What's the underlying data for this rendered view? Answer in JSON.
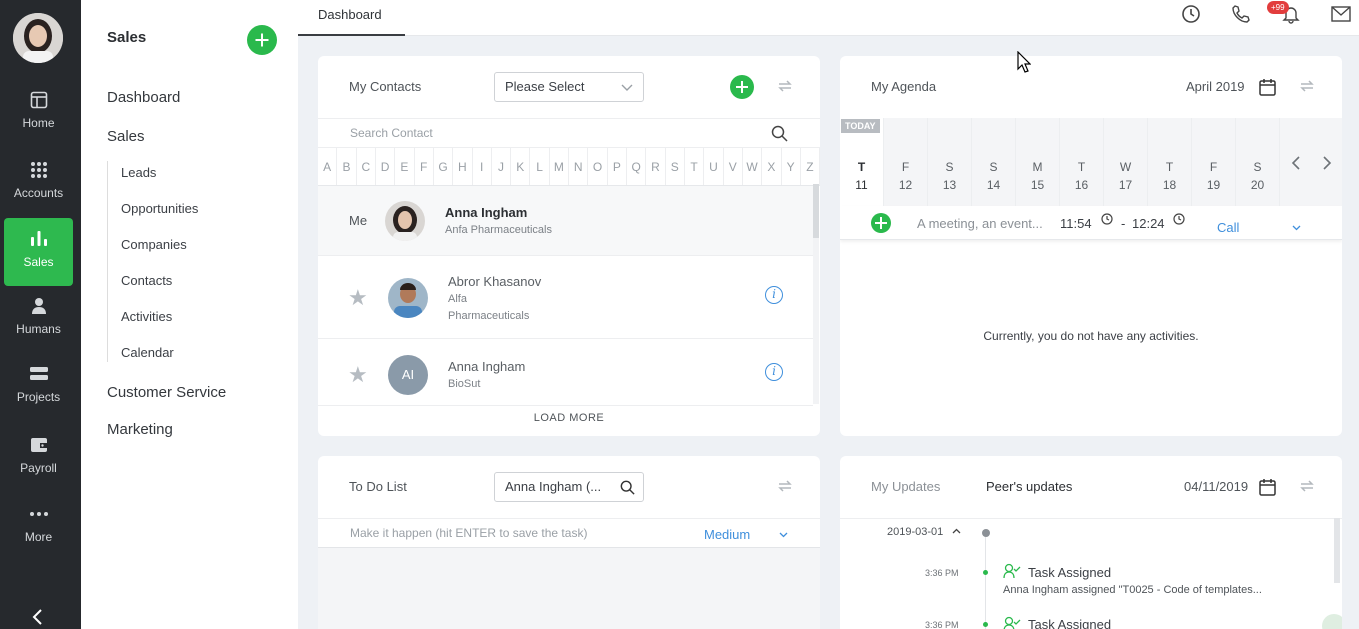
{
  "nav": {
    "items": [
      {
        "label": "Home",
        "icon": "home-icon"
      },
      {
        "label": "Accounts",
        "icon": "grid-icon"
      },
      {
        "label": "Sales",
        "icon": "bar-chart-icon"
      },
      {
        "label": "Humans",
        "icon": "person-icon"
      },
      {
        "label": "Projects",
        "icon": "projects-icon"
      },
      {
        "label": "Payroll",
        "icon": "wallet-icon"
      },
      {
        "label": "More",
        "icon": "more-icon"
      }
    ],
    "active": "Sales"
  },
  "sidebar": {
    "title": "Sales",
    "sections": [
      "Dashboard",
      "Sales",
      "Customer Service",
      "Marketing"
    ],
    "sub_items": [
      "Leads",
      "Opportunities",
      "Companies",
      "Contacts",
      "Activities",
      "Calendar"
    ]
  },
  "topbar": {
    "tab": "Dashboard",
    "badge": "+99"
  },
  "contacts": {
    "title": "My Contacts",
    "select": "Please Select",
    "search_placeholder": "Search Contact",
    "letters": [
      "A",
      "B",
      "C",
      "D",
      "E",
      "F",
      "G",
      "H",
      "I",
      "J",
      "K",
      "L",
      "M",
      "N",
      "O",
      "P",
      "Q",
      "R",
      "S",
      "T",
      "U",
      "V",
      "W",
      "X",
      "Y",
      "Z"
    ],
    "me_label": "Me",
    "me": {
      "name": "Anna Ingham",
      "company": "Anfa Pharmaceuticals"
    },
    "rows": [
      {
        "name": "Abror Khasanov",
        "company_line1": "Alfa",
        "company_line2": "Pharmaceuticals",
        "initials": ""
      },
      {
        "name": "Anna Ingham",
        "company_line1": "BioSut",
        "company_line2": "",
        "initials": "AI"
      }
    ],
    "load_more": "LOAD MORE"
  },
  "agenda": {
    "title": "My Agenda",
    "month": "April 2019",
    "today_label": "TODAY",
    "days": [
      {
        "dow": "T",
        "date": "11"
      },
      {
        "dow": "F",
        "date": "12"
      },
      {
        "dow": "S",
        "date": "13"
      },
      {
        "dow": "S",
        "date": "14"
      },
      {
        "dow": "M",
        "date": "15"
      },
      {
        "dow": "T",
        "date": "16"
      },
      {
        "dow": "W",
        "date": "17"
      },
      {
        "dow": "T",
        "date": "18"
      },
      {
        "dow": "F",
        "date": "19"
      },
      {
        "dow": "S",
        "date": "20"
      }
    ],
    "meeting_placeholder": "A meeting, an event...",
    "time_start": "11:54",
    "time_sep": "-",
    "time_end": "12:24",
    "type": "Call",
    "empty": "Currently, you do not have any activities."
  },
  "todo": {
    "title": "To Do List",
    "filter": "Anna Ingham (...",
    "placeholder": "Make it happen (hit ENTER to save the task)",
    "priority": "Medium"
  },
  "updates": {
    "tab_my": "My Updates",
    "tab_peer": "Peer's updates",
    "date": "04/11/2019",
    "group_date": "2019-03-01",
    "items": [
      {
        "time": "3:36 PM",
        "title": "Task Assigned",
        "desc": "Anna Ingham assigned \"T0025 - Code of templates..."
      },
      {
        "time": "3:36 PM",
        "title": "Task Assigned",
        "desc": ""
      }
    ]
  }
}
